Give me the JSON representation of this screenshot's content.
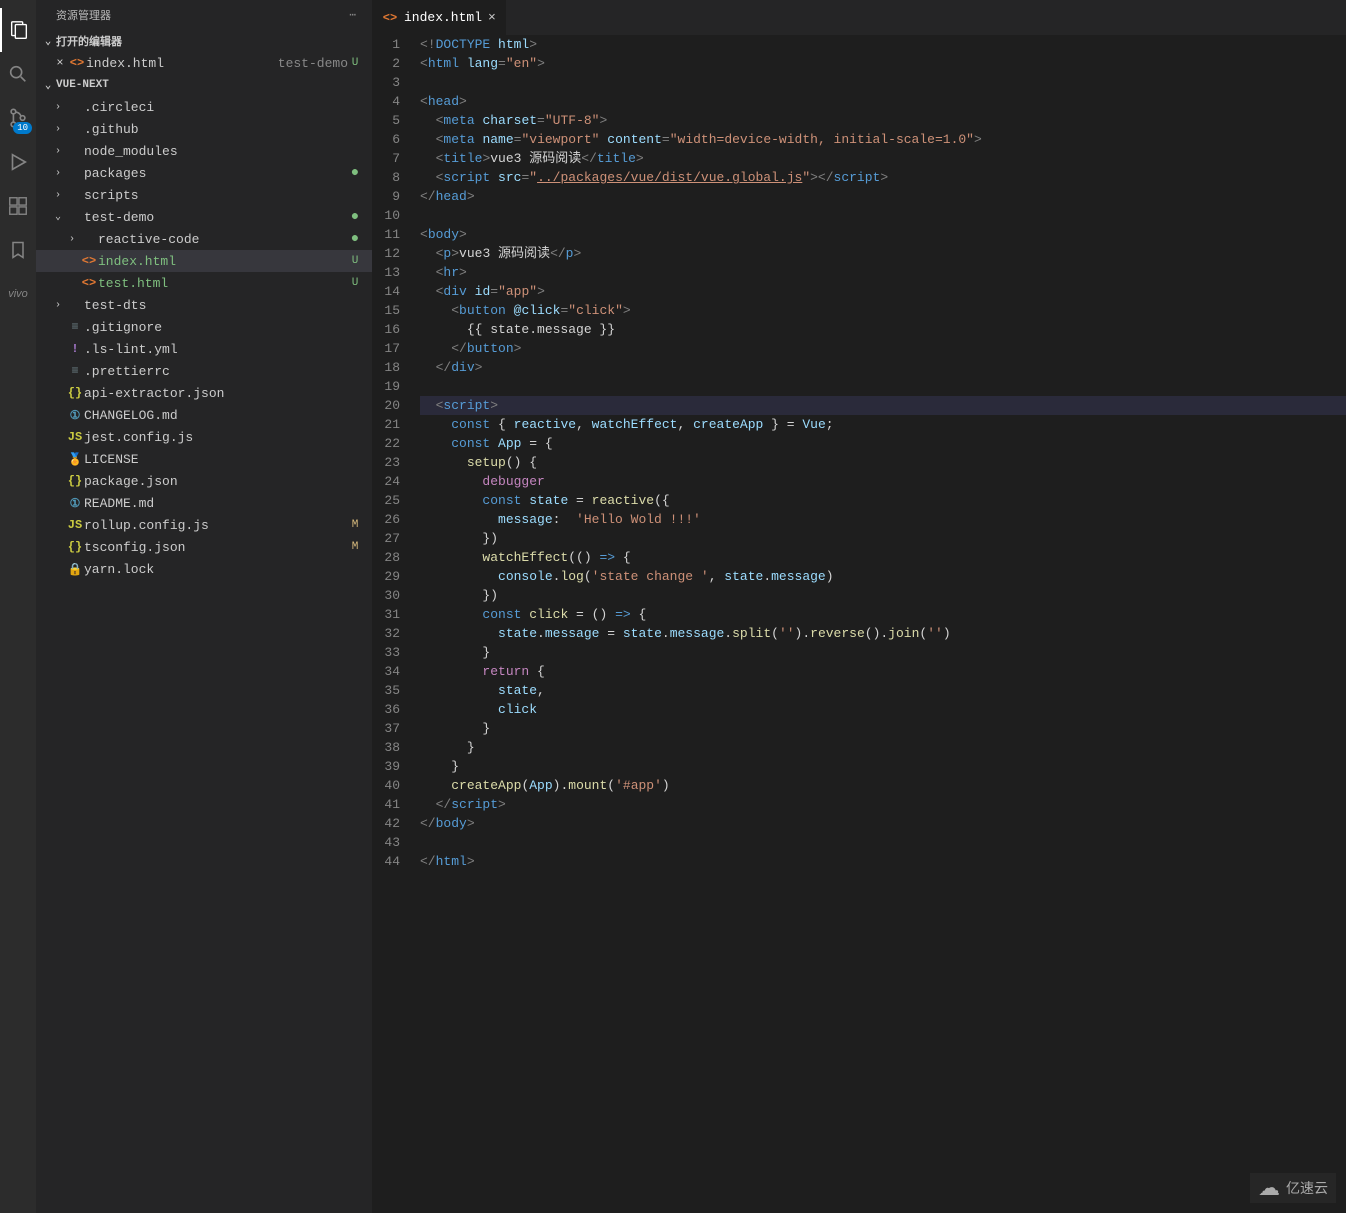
{
  "sidebar": {
    "title": "资源管理器",
    "sections": {
      "openEditors": {
        "title": "打开的编辑器"
      },
      "project": {
        "title": "VUE-NEXT"
      }
    },
    "openEditors": [
      {
        "icon": "html",
        "name": "index.html",
        "desc": "test-demo",
        "status": "U"
      }
    ],
    "tree": [
      {
        "depth": 0,
        "kind": "folder",
        "name": ".circleci",
        "open": false
      },
      {
        "depth": 0,
        "kind": "folder",
        "name": ".github",
        "open": false
      },
      {
        "depth": 0,
        "kind": "folder",
        "name": "node_modules",
        "open": false
      },
      {
        "depth": 0,
        "kind": "folder",
        "name": "packages",
        "open": false,
        "status": "dot"
      },
      {
        "depth": 0,
        "kind": "folder",
        "name": "scripts",
        "open": false
      },
      {
        "depth": 0,
        "kind": "folder",
        "name": "test-demo",
        "open": true,
        "status": "dot"
      },
      {
        "depth": 1,
        "kind": "folder",
        "name": "reactive-code",
        "open": false,
        "status": "dot"
      },
      {
        "depth": 1,
        "kind": "file",
        "icon": "html",
        "name": "index.html",
        "status": "U",
        "active": true,
        "cls": "file-u"
      },
      {
        "depth": 1,
        "kind": "file",
        "icon": "html",
        "name": "test.html",
        "status": "U",
        "cls": "file-u"
      },
      {
        "depth": 0,
        "kind": "folder",
        "name": "test-dts",
        "open": false
      },
      {
        "depth": 0,
        "kind": "file",
        "icon": "conf",
        "name": ".gitignore"
      },
      {
        "depth": 0,
        "kind": "file",
        "icon": "yml",
        "name": ".ls-lint.yml"
      },
      {
        "depth": 0,
        "kind": "file",
        "icon": "conf",
        "name": ".prettierrc"
      },
      {
        "depth": 0,
        "kind": "file",
        "icon": "json",
        "name": "api-extractor.json"
      },
      {
        "depth": 0,
        "kind": "file",
        "icon": "md",
        "name": "CHANGELOG.md"
      },
      {
        "depth": 0,
        "kind": "file",
        "icon": "js",
        "name": "jest.config.js"
      },
      {
        "depth": 0,
        "kind": "file",
        "icon": "lic",
        "name": "LICENSE"
      },
      {
        "depth": 0,
        "kind": "file",
        "icon": "json",
        "name": "package.json"
      },
      {
        "depth": 0,
        "kind": "file",
        "icon": "md",
        "name": "README.md"
      },
      {
        "depth": 0,
        "kind": "file",
        "icon": "js",
        "name": "rollup.config.js",
        "status": "M"
      },
      {
        "depth": 0,
        "kind": "file",
        "icon": "json",
        "name": "tsconfig.json",
        "status": "M"
      },
      {
        "depth": 0,
        "kind": "file",
        "icon": "txt",
        "name": "yarn.lock"
      }
    ]
  },
  "scmBadge": "10",
  "tab": {
    "name": "index.html"
  },
  "watermark": "亿速云",
  "code": [
    [
      {
        "c": "t-pun",
        "t": "<!"
      },
      {
        "c": "t-tag",
        "t": "DOCTYPE "
      },
      {
        "c": "t-attr",
        "t": "html"
      },
      {
        "c": "t-pun",
        "t": ">"
      }
    ],
    [
      {
        "c": "t-pun",
        "t": "<"
      },
      {
        "c": "t-tag",
        "t": "html "
      },
      {
        "c": "t-attr",
        "t": "lang"
      },
      {
        "c": "t-pun",
        "t": "="
      },
      {
        "c": "t-str",
        "t": "\"en\""
      },
      {
        "c": "t-pun",
        "t": ">"
      }
    ],
    [],
    [
      {
        "c": "t-pun",
        "t": "<"
      },
      {
        "c": "t-tag",
        "t": "head"
      },
      {
        "c": "t-pun",
        "t": ">"
      }
    ],
    [
      {
        "i": 1
      },
      {
        "c": "t-pun",
        "t": "<"
      },
      {
        "c": "t-tag",
        "t": "meta "
      },
      {
        "c": "t-attr",
        "t": "charset"
      },
      {
        "c": "t-pun",
        "t": "="
      },
      {
        "c": "t-str",
        "t": "\"UTF-8\""
      },
      {
        "c": "t-pun",
        "t": ">"
      }
    ],
    [
      {
        "i": 1
      },
      {
        "c": "t-pun",
        "t": "<"
      },
      {
        "c": "t-tag",
        "t": "meta "
      },
      {
        "c": "t-attr",
        "t": "name"
      },
      {
        "c": "t-pun",
        "t": "="
      },
      {
        "c": "t-str",
        "t": "\"viewport\" "
      },
      {
        "c": "t-attr",
        "t": "content"
      },
      {
        "c": "t-pun",
        "t": "="
      },
      {
        "c": "t-str",
        "t": "\"width=device-width, initial-scale=1.0\""
      },
      {
        "c": "t-pun",
        "t": ">"
      }
    ],
    [
      {
        "i": 1
      },
      {
        "c": "t-pun",
        "t": "<"
      },
      {
        "c": "t-tag",
        "t": "title"
      },
      {
        "c": "t-pun",
        "t": ">"
      },
      {
        "c": "t-txt",
        "t": "vue3 源码阅读"
      },
      {
        "c": "t-pun",
        "t": "</"
      },
      {
        "c": "t-tag",
        "t": "title"
      },
      {
        "c": "t-pun",
        "t": ">"
      }
    ],
    [
      {
        "i": 1
      },
      {
        "c": "t-pun",
        "t": "<"
      },
      {
        "c": "t-tag",
        "t": "script "
      },
      {
        "c": "t-attr",
        "t": "src"
      },
      {
        "c": "t-pun",
        "t": "="
      },
      {
        "c": "t-str",
        "t": "\""
      },
      {
        "c": "t-link",
        "t": "../packages/vue/dist/vue.global.js"
      },
      {
        "c": "t-str",
        "t": "\""
      },
      {
        "c": "t-pun",
        "t": "></"
      },
      {
        "c": "t-tag",
        "t": "script"
      },
      {
        "c": "t-pun",
        "t": ">"
      }
    ],
    [
      {
        "c": "t-pun",
        "t": "</"
      },
      {
        "c": "t-tag",
        "t": "head"
      },
      {
        "c": "t-pun",
        "t": ">"
      }
    ],
    [],
    [
      {
        "c": "t-pun",
        "t": "<"
      },
      {
        "c": "t-tag",
        "t": "body"
      },
      {
        "c": "t-pun",
        "t": ">"
      }
    ],
    [
      {
        "i": 1
      },
      {
        "c": "t-pun",
        "t": "<"
      },
      {
        "c": "t-tag",
        "t": "p"
      },
      {
        "c": "t-pun",
        "t": ">"
      },
      {
        "c": "t-txt",
        "t": "vue3 源码阅读"
      },
      {
        "c": "t-pun",
        "t": "</"
      },
      {
        "c": "t-tag",
        "t": "p"
      },
      {
        "c": "t-pun",
        "t": ">"
      }
    ],
    [
      {
        "i": 1
      },
      {
        "c": "t-pun",
        "t": "<"
      },
      {
        "c": "t-tag",
        "t": "hr"
      },
      {
        "c": "t-pun",
        "t": ">"
      }
    ],
    [
      {
        "i": 1
      },
      {
        "c": "t-pun",
        "t": "<"
      },
      {
        "c": "t-tag",
        "t": "div "
      },
      {
        "c": "t-attr",
        "t": "id"
      },
      {
        "c": "t-pun",
        "t": "="
      },
      {
        "c": "t-str",
        "t": "\"app\""
      },
      {
        "c": "t-pun",
        "t": ">"
      }
    ],
    [
      {
        "i": 2
      },
      {
        "c": "t-pun",
        "t": "<"
      },
      {
        "c": "t-tag",
        "t": "button "
      },
      {
        "c": "t-attr",
        "t": "@click"
      },
      {
        "c": "t-pun",
        "t": "="
      },
      {
        "c": "t-str",
        "t": "\"click\""
      },
      {
        "c": "t-pun",
        "t": ">"
      }
    ],
    [
      {
        "i": 3
      },
      {
        "c": "t-txt",
        "t": "{{ state.message }}"
      }
    ],
    [
      {
        "i": 2
      },
      {
        "c": "t-pun",
        "t": "</"
      },
      {
        "c": "t-tag",
        "t": "button"
      },
      {
        "c": "t-pun",
        "t": ">"
      }
    ],
    [
      {
        "i": 1
      },
      {
        "c": "t-pun",
        "t": "</"
      },
      {
        "c": "t-tag",
        "t": "div"
      },
      {
        "c": "t-pun",
        "t": ">"
      }
    ],
    [],
    [
      {
        "hl": true,
        "i": 1
      },
      {
        "c": "t-pun",
        "t": "<"
      },
      {
        "c": "t-tag",
        "t": "script"
      },
      {
        "c": "t-pun",
        "t": ">"
      }
    ],
    [
      {
        "i": 2
      },
      {
        "c": "t-const",
        "t": "const "
      },
      {
        "c": "t-txt",
        "t": "{ "
      },
      {
        "c": "t-var",
        "t": "reactive"
      },
      {
        "c": "t-txt",
        "t": ", "
      },
      {
        "c": "t-var",
        "t": "watchEffect"
      },
      {
        "c": "t-txt",
        "t": ", "
      },
      {
        "c": "t-var",
        "t": "createApp"
      },
      {
        "c": "t-txt",
        "t": " } = "
      },
      {
        "c": "t-var",
        "t": "Vue"
      },
      {
        "c": "t-txt",
        "t": ";"
      }
    ],
    [
      {
        "i": 2
      },
      {
        "c": "t-const",
        "t": "const "
      },
      {
        "c": "t-var",
        "t": "App"
      },
      {
        "c": "t-txt",
        "t": " = {"
      }
    ],
    [
      {
        "i": 3
      },
      {
        "c": "t-fn",
        "t": "setup"
      },
      {
        "c": "t-txt",
        "t": "() {"
      }
    ],
    [
      {
        "i": 4
      },
      {
        "c": "t-kw",
        "t": "debugger"
      }
    ],
    [
      {
        "i": 4
      },
      {
        "c": "t-const",
        "t": "const "
      },
      {
        "c": "t-var",
        "t": "state"
      },
      {
        "c": "t-txt",
        "t": " = "
      },
      {
        "c": "t-fn",
        "t": "reactive"
      },
      {
        "c": "t-txt",
        "t": "({"
      }
    ],
    [
      {
        "i": 5
      },
      {
        "c": "t-var",
        "t": "message"
      },
      {
        "c": "t-txt",
        "t": ":  "
      },
      {
        "c": "t-str",
        "t": "'Hello Wold !!!'"
      }
    ],
    [
      {
        "i": 4
      },
      {
        "c": "t-txt",
        "t": "})"
      }
    ],
    [
      {
        "i": 4
      },
      {
        "c": "t-fn",
        "t": "watchEffect"
      },
      {
        "c": "t-txt",
        "t": "(() "
      },
      {
        "c": "t-const",
        "t": "=>"
      },
      {
        "c": "t-txt",
        "t": " {"
      }
    ],
    [
      {
        "i": 5
      },
      {
        "c": "t-var",
        "t": "console"
      },
      {
        "c": "t-txt",
        "t": "."
      },
      {
        "c": "t-fn",
        "t": "log"
      },
      {
        "c": "t-txt",
        "t": "("
      },
      {
        "c": "t-str",
        "t": "'state change '"
      },
      {
        "c": "t-txt",
        "t": ", "
      },
      {
        "c": "t-var",
        "t": "state"
      },
      {
        "c": "t-txt",
        "t": "."
      },
      {
        "c": "t-var",
        "t": "message"
      },
      {
        "c": "t-txt",
        "t": ")"
      }
    ],
    [
      {
        "i": 4
      },
      {
        "c": "t-txt",
        "t": "})"
      }
    ],
    [
      {
        "i": 4
      },
      {
        "c": "t-const",
        "t": "const "
      },
      {
        "c": "t-fn",
        "t": "click"
      },
      {
        "c": "t-txt",
        "t": " = () "
      },
      {
        "c": "t-const",
        "t": "=>"
      },
      {
        "c": "t-txt",
        "t": " {"
      }
    ],
    [
      {
        "i": 5
      },
      {
        "c": "t-var",
        "t": "state"
      },
      {
        "c": "t-txt",
        "t": "."
      },
      {
        "c": "t-var",
        "t": "message"
      },
      {
        "c": "t-txt",
        "t": " = "
      },
      {
        "c": "t-var",
        "t": "state"
      },
      {
        "c": "t-txt",
        "t": "."
      },
      {
        "c": "t-var",
        "t": "message"
      },
      {
        "c": "t-txt",
        "t": "."
      },
      {
        "c": "t-fn",
        "t": "split"
      },
      {
        "c": "t-txt",
        "t": "("
      },
      {
        "c": "t-str",
        "t": "''"
      },
      {
        "c": "t-txt",
        "t": ")."
      },
      {
        "c": "t-fn",
        "t": "reverse"
      },
      {
        "c": "t-txt",
        "t": "()."
      },
      {
        "c": "t-fn",
        "t": "join"
      },
      {
        "c": "t-txt",
        "t": "("
      },
      {
        "c": "t-str",
        "t": "''"
      },
      {
        "c": "t-txt",
        "t": ")"
      }
    ],
    [
      {
        "i": 4
      },
      {
        "c": "t-txt",
        "t": "}"
      }
    ],
    [
      {
        "i": 4
      },
      {
        "c": "t-kw",
        "t": "return"
      },
      {
        "c": "t-txt",
        "t": " {"
      }
    ],
    [
      {
        "i": 5
      },
      {
        "c": "t-var",
        "t": "state"
      },
      {
        "c": "t-txt",
        "t": ","
      }
    ],
    [
      {
        "i": 5
      },
      {
        "c": "t-var",
        "t": "click"
      }
    ],
    [
      {
        "i": 4
      },
      {
        "c": "t-txt",
        "t": "}"
      }
    ],
    [
      {
        "i": 3
      },
      {
        "c": "t-txt",
        "t": "}"
      }
    ],
    [
      {
        "i": 2
      },
      {
        "c": "t-txt",
        "t": "}"
      }
    ],
    [
      {
        "i": 2
      },
      {
        "c": "t-fn",
        "t": "createApp"
      },
      {
        "c": "t-txt",
        "t": "("
      },
      {
        "c": "t-var",
        "t": "App"
      },
      {
        "c": "t-txt",
        "t": ")."
      },
      {
        "c": "t-fn",
        "t": "mount"
      },
      {
        "c": "t-txt",
        "t": "("
      },
      {
        "c": "t-str",
        "t": "'#app'"
      },
      {
        "c": "t-txt",
        "t": ")"
      }
    ],
    [
      {
        "i": 1
      },
      {
        "c": "t-pun",
        "t": "</"
      },
      {
        "c": "t-tag",
        "t": "script"
      },
      {
        "c": "t-pun",
        "t": ">"
      }
    ],
    [
      {
        "c": "t-pun",
        "t": "</"
      },
      {
        "c": "t-tag",
        "t": "body"
      },
      {
        "c": "t-pun",
        "t": ">"
      }
    ],
    [],
    [
      {
        "c": "t-pun",
        "t": "</"
      },
      {
        "c": "t-tag",
        "t": "html"
      },
      {
        "c": "t-pun",
        "t": ">"
      }
    ]
  ]
}
